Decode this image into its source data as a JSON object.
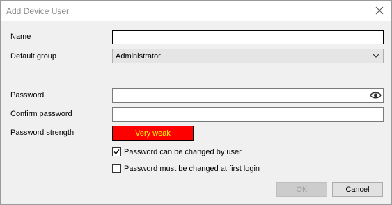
{
  "window": {
    "title": "Add Device User",
    "close_icon": "close-icon"
  },
  "form": {
    "name_label": "Name",
    "name_value": "",
    "default_group_label": "Default group",
    "default_group_value": "Administrator",
    "password_label": "Password",
    "password_value": "",
    "confirm_password_label": "Confirm password",
    "confirm_password_value": "",
    "password_strength_label": "Password strength",
    "password_strength_value": "Very weak",
    "password_strength_color": "#ff0000",
    "password_strength_text_color": "#ffff00",
    "can_change_label": "Password can be changed by user",
    "can_change_checked": true,
    "must_change_label": "Password must be changed at first login",
    "must_change_checked": false
  },
  "buttons": {
    "ok_label": "OK",
    "ok_enabled": false,
    "cancel_label": "Cancel"
  }
}
